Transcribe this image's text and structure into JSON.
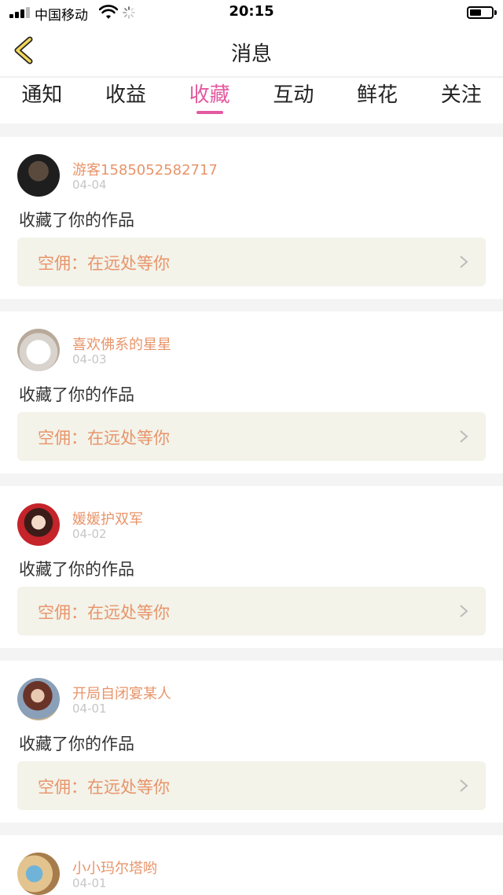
{
  "status_bar": {
    "carrier": "中国移动",
    "time": "20:15"
  },
  "header": {
    "title": "消息",
    "back_icon": "chevron-left-icon"
  },
  "tabs": [
    {
      "label": "通知",
      "active": false
    },
    {
      "label": "收益",
      "active": false
    },
    {
      "label": "收藏",
      "active": true
    },
    {
      "label": "互动",
      "active": false
    },
    {
      "label": "鲜花",
      "active": false
    },
    {
      "label": "关注",
      "active": false
    }
  ],
  "colors": {
    "accent": "#e45aa0",
    "username": "#e8946a",
    "work_box_bg": "#f3f3ea"
  },
  "messages": [
    {
      "username": "游客1585052582717",
      "date": "04-04",
      "action": "收藏了你的作品",
      "work": "空佣：在远处等你"
    },
    {
      "username": "喜欢佛系的星星",
      "date": "04-03",
      "action": "收藏了你的作品",
      "work": "空佣：在远处等你"
    },
    {
      "username": "媛媛护双军",
      "date": "04-02",
      "action": "收藏了你的作品",
      "work": "空佣：在远处等你"
    },
    {
      "username": "开局自闭宴某人",
      "date": "04-01",
      "action": "收藏了你的作品",
      "work": "空佣：在远处等你"
    },
    {
      "username": "小小玛尔塔哟",
      "date": "04-01"
    }
  ]
}
